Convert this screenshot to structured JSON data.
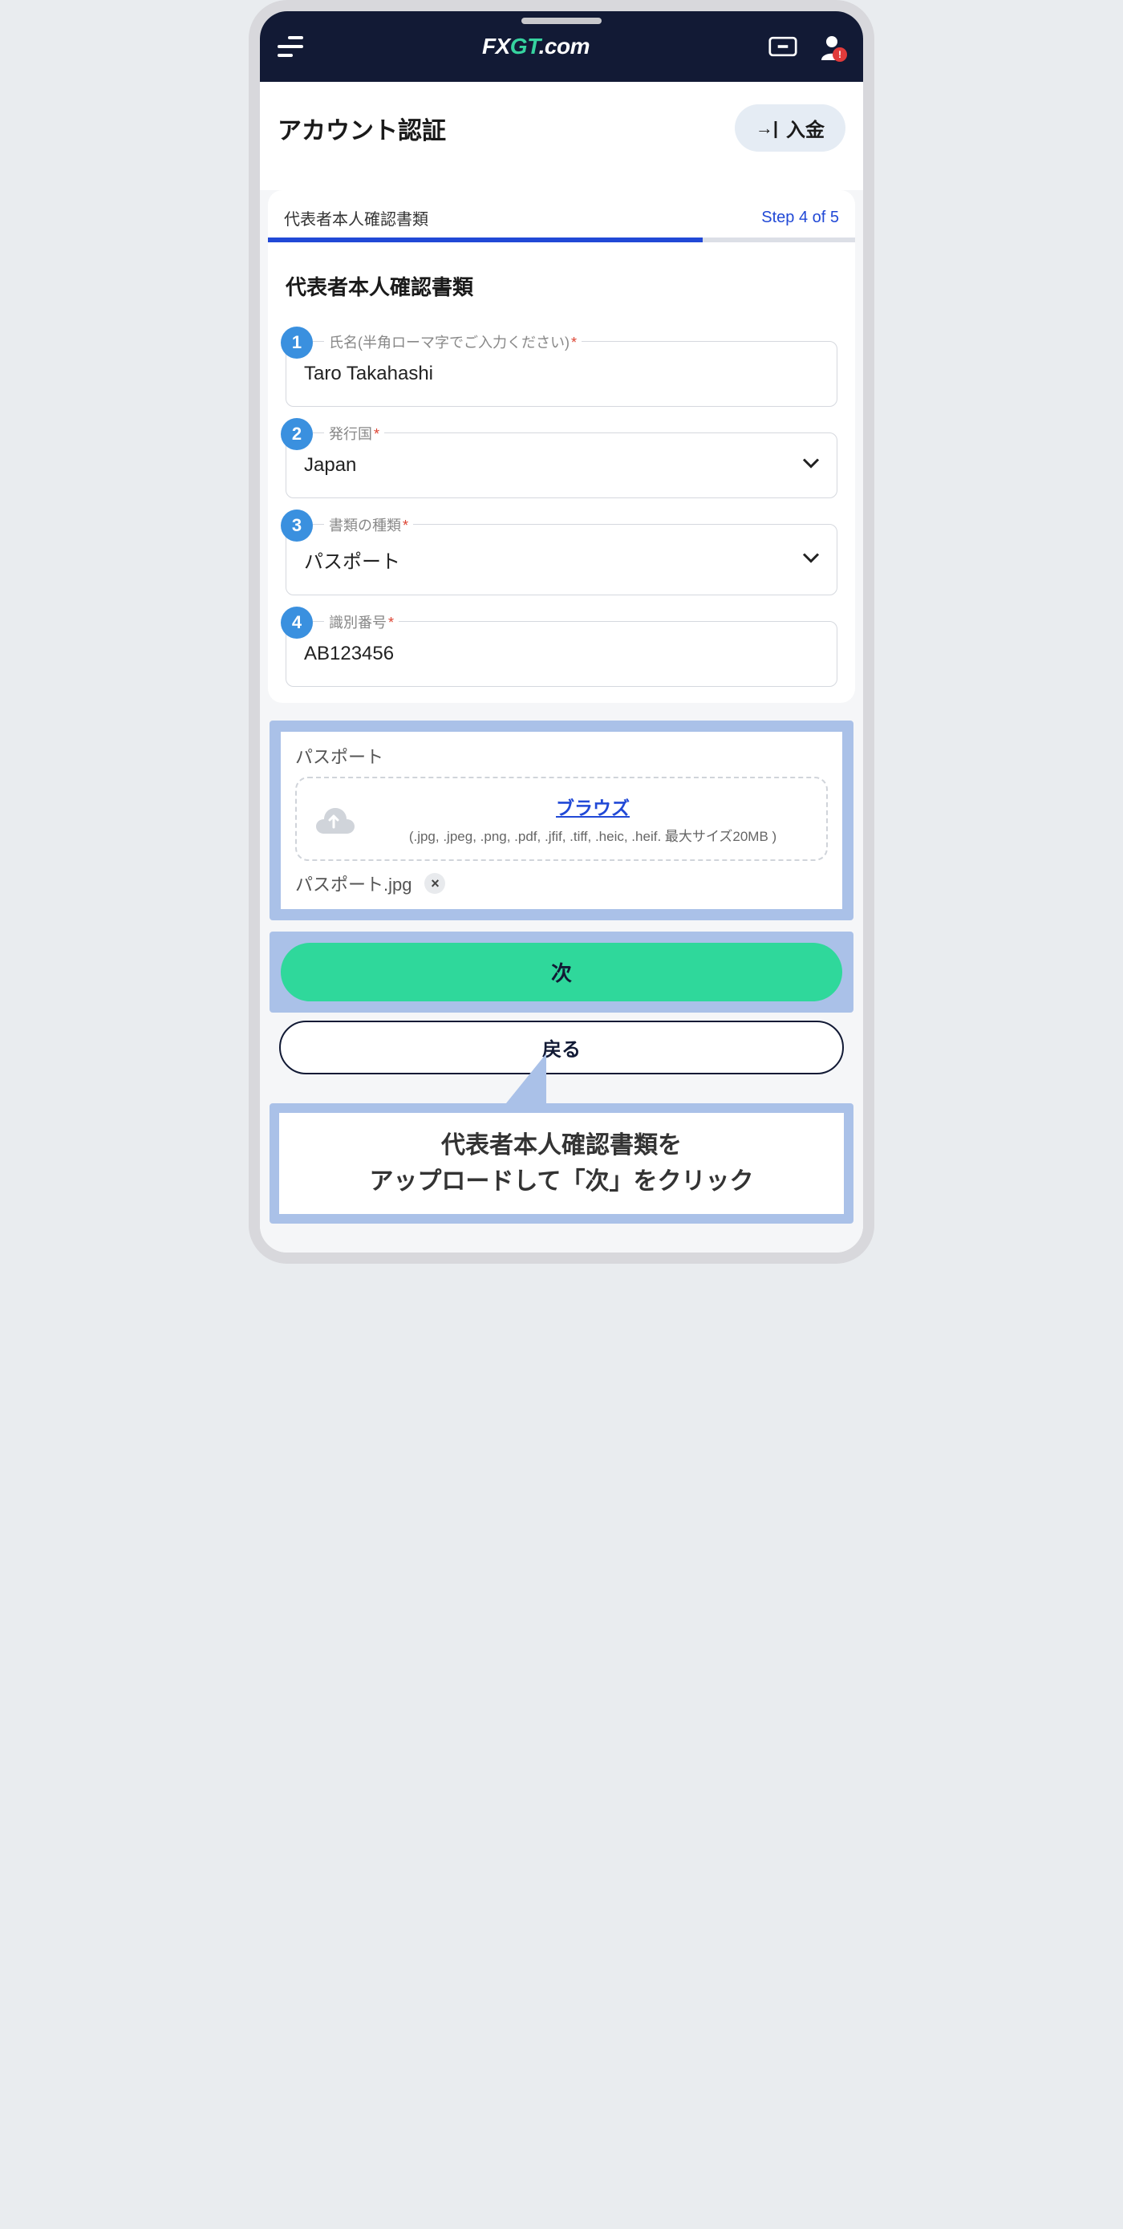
{
  "header": {
    "logo_prefix": "FX",
    "logo_gt": "GT",
    "logo_suffix": ".com"
  },
  "page": {
    "title": "アカウント認証",
    "deposit_label": "入金"
  },
  "step": {
    "title": "代表者本人確認書類",
    "counter": "Step 4 of 5"
  },
  "section": {
    "heading": "代表者本人確認書類"
  },
  "fields": {
    "name": {
      "badge": "1",
      "label": "氏名(半角ローマ字でご入力ください)",
      "value": "Taro Takahashi"
    },
    "country": {
      "badge": "2",
      "label": "発行国",
      "value": "Japan"
    },
    "doctype": {
      "badge": "3",
      "label": "書類の種類",
      "value": "パスポート"
    },
    "idnum": {
      "badge": "4",
      "label": "識別番号",
      "value": "AB123456"
    }
  },
  "upload": {
    "title": "パスポート",
    "browse_label": "ブラウズ",
    "hint": "(.jpg, .jpeg, .png, .pdf, .jfif, .tiff, .heic, .heif. 最大サイズ20MB )",
    "uploaded_file": "パスポート.jpg"
  },
  "buttons": {
    "next": "次",
    "back": "戻る"
  },
  "callout": {
    "line1": "代表者本人確認書類を",
    "line2": "アップロードして「次」をクリック"
  }
}
